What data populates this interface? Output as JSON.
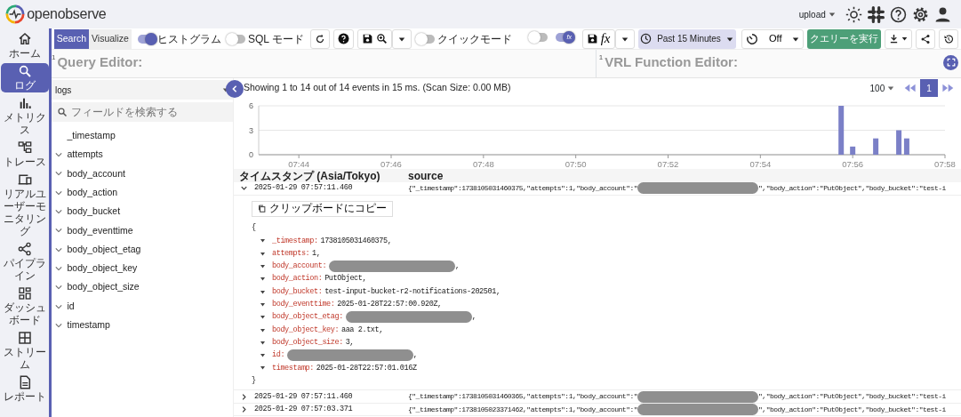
{
  "header": {
    "logo_text": "openobserve",
    "org": "upload"
  },
  "nav": [
    {
      "label": "ホーム",
      "selected": false
    },
    {
      "label": "ログ",
      "selected": true
    },
    {
      "label": "メトリクス",
      "selected": false
    },
    {
      "label": "トレース",
      "selected": false
    },
    {
      "label": "リアルユーザーモニタリング",
      "selected": false
    },
    {
      "label": "パイプライン",
      "selected": false
    },
    {
      "label": "ダッシュボード",
      "selected": false
    },
    {
      "label": "ストリーム",
      "selected": false
    },
    {
      "label": "レポート",
      "selected": false
    }
  ],
  "toolbar": {
    "tabs": [
      {
        "label": "Search",
        "selected": true
      },
      {
        "label": "Visualize",
        "selected": false
      }
    ],
    "toggles": [
      {
        "label": "ヒストグラム",
        "on": true
      },
      {
        "label": "SQL モード",
        "on": false
      }
    ],
    "quick_mode": {
      "label": "クイックモード",
      "on": false
    },
    "function_toggles": [
      {
        "kind": "plain",
        "on": false
      },
      {
        "kind": "fx",
        "on": true,
        "thumb_text": "fx"
      }
    ],
    "function_button_text": "fx",
    "time_range": "Past 15 Minutes",
    "refresh": "Off",
    "run_button": "クエリーを実行"
  },
  "query_editor": {
    "line_number": "1",
    "placeholder": "Query Editor:"
  },
  "vrl_editor": {
    "line_number": "1",
    "placeholder": "VRL Function Editor:"
  },
  "fields_panel": {
    "stream": "logs",
    "search_placeholder": "フィールドを検索する",
    "fields": [
      {
        "name": "_timestamp",
        "expandable": false
      },
      {
        "name": "attempts",
        "expandable": true
      },
      {
        "name": "body_account",
        "expandable": true
      },
      {
        "name": "body_action",
        "expandable": true
      },
      {
        "name": "body_bucket",
        "expandable": true
      },
      {
        "name": "body_eventtime",
        "expandable": true
      },
      {
        "name": "body_object_etag",
        "expandable": true
      },
      {
        "name": "body_object_key",
        "expandable": true
      },
      {
        "name": "body_object_size",
        "expandable": true
      },
      {
        "name": "id",
        "expandable": true
      },
      {
        "name": "timestamp",
        "expandable": true
      }
    ]
  },
  "results": {
    "summary": "Showing 1 to 14 out of 14 events in 15 ms. (Scan Size: 0.00 MB)",
    "per_page": "100",
    "pages": [
      {
        "label": "1",
        "selected": true
      }
    ],
    "chart_data": {
      "type": "bar",
      "x": [
        475.75,
        476,
        476.5,
        477,
        477.17
      ],
      "values": [
        6,
        1,
        2,
        3,
        2
      ],
      "xlim": [
        463.13,
        478
      ],
      "ylim": [
        0,
        6
      ],
      "xticks": [
        {
          "value": 464,
          "label": "07:44"
        },
        {
          "value": 466,
          "label": "07:46"
        },
        {
          "value": 468,
          "label": "07:48"
        },
        {
          "value": 470,
          "label": "07:50"
        },
        {
          "value": 472,
          "label": "07:52"
        },
        {
          "value": 474,
          "label": "07:54"
        },
        {
          "value": 476,
          "label": "07:56"
        },
        {
          "value": 478,
          "label": "07:58"
        }
      ],
      "yticks": [
        0,
        3,
        6
      ]
    },
    "table": {
      "columns": [
        "タイムスタンプ (Asia/Tokyo)",
        "source"
      ],
      "rows": [
        {
          "timestamp": "2025-01-29 07:57:11.460",
          "expanded": true,
          "source": [
            {
              "kind": "text",
              "text": "{\"_timestamp\":1738105031460375,\"attempts\":1,\"body_account\":\""
            },
            {
              "kind": "redacted"
            },
            {
              "kind": "text",
              "text": "\",\"body_action\":\"PutObject\",\"body_bucket\":\"test-i"
            }
          ]
        },
        {
          "timestamp": "2025-01-29 07:57:11.460",
          "expanded": false,
          "source": [
            {
              "kind": "text",
              "text": "{\"_timestamp\":1738105031460365,\"attempts\":1,\"body_account\":\""
            },
            {
              "kind": "redacted"
            },
            {
              "kind": "text",
              "text": "\",\"body_action\":\"PutObject\",\"body_bucket\":\"test-i"
            }
          ]
        },
        {
          "timestamp": "2025-01-29 07:57:03.371",
          "expanded": false,
          "source": [
            {
              "kind": "text",
              "text": "{\"_timestamp\":1738105023371462,\"attempts\":1,\"body_account\":\""
            },
            {
              "kind": "redacted"
            },
            {
              "kind": "text",
              "text": "\",\"body_action\":\"PutObject\",\"body_bucket\":\"test-i"
            }
          ]
        }
      ]
    },
    "detail": {
      "copy_button": "クリップボードにコピー",
      "open": "{",
      "close": "}",
      "fields": [
        {
          "key": "_timestamp:",
          "value": "1738105031460375,"
        },
        {
          "key": "attempts:",
          "value": "1,"
        },
        {
          "key": "body_account:",
          "redacted": true,
          "value": ","
        },
        {
          "key": "body_action:",
          "value": "PutObject,"
        },
        {
          "key": "body_bucket:",
          "value": "test-input-bucket-r2-notifications-202501,"
        },
        {
          "key": "body_eventtime:",
          "value": "2025-01-28T22:57:00.920Z,"
        },
        {
          "key": "body_object_etag:",
          "redacted": true,
          "value": ","
        },
        {
          "key": "body_object_key:",
          "value": "aaa 2.txt,"
        },
        {
          "key": "body_object_size:",
          "value": "3,"
        },
        {
          "key": "id:",
          "redacted": true,
          "value": ","
        },
        {
          "key": "timestamp:",
          "value": "2025-01-28T22:57:01.016Z"
        }
      ]
    }
  }
}
